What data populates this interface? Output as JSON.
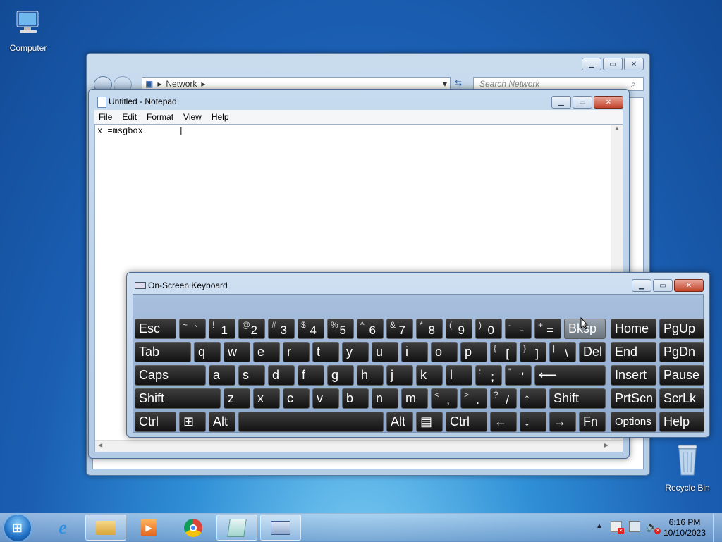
{
  "desktop": {
    "icons": [
      {
        "label": "Computer"
      },
      {
        "label": "Recycle Bin"
      }
    ]
  },
  "explorer": {
    "breadcrumb": "Network",
    "search_placeholder": "Search Network"
  },
  "notepad": {
    "title": "Untitled - Notepad",
    "menu": [
      "File",
      "Edit",
      "Format",
      "View",
      "Help"
    ],
    "text": "x =msgbox       |"
  },
  "osk": {
    "title": "On-Screen Keyboard",
    "keys": {
      "esc": "Esc",
      "tilde_top": "~",
      "tilde_bot": "`",
      "n1_top": "!",
      "n1": "1",
      "n2_top": "@",
      "n2": "2",
      "n3_top": "#",
      "n3": "3",
      "n4_top": "$",
      "n4": "4",
      "n5_top": "%",
      "n5": "5",
      "n6_top": "^",
      "n6": "6",
      "n7_top": "&",
      "n7": "7",
      "n8_top": "*",
      "n8": "8",
      "n9_top": "(",
      "n9": "9",
      "n0_top": ")",
      "n0": "0",
      "minus_top": "-",
      "minus": "-",
      "plus_top": "+",
      "equals": "=",
      "bksp": "Bksp",
      "home": "Home",
      "pgup": "PgUp",
      "tab": "Tab",
      "q": "q",
      "w": "w",
      "e": "e",
      "r": "r",
      "t": "t",
      "y": "y",
      "u": "u",
      "i": "i",
      "o": "o",
      "p": "p",
      "lbrace_top": "{",
      "lbrace": "[",
      "rbrace_top": "}",
      "rbrace": "]",
      "pipe_top": "|",
      "backslash": "\\",
      "del": "Del",
      "end": "End",
      "pgdn": "PgDn",
      "caps": "Caps",
      "a": "a",
      "s": "s",
      "d": "d",
      "f": "f",
      "g": "g",
      "h": "h",
      "j": "j",
      "k": "k",
      "l": "l",
      "colon_top": ":",
      "semicolon": ";",
      "quote_top": "\"",
      "quote": "'",
      "enter": "⟵",
      "insert": "Insert",
      "pause": "Pause",
      "shift": "Shift",
      "z": "z",
      "x": "x",
      "c": "c",
      "v": "v",
      "b": "b",
      "n": "n",
      "m": "m",
      "lt_top": "<",
      "comma": ",",
      "gt_top": ">",
      "period": ".",
      "q_top": "?",
      "slash": "/",
      "up": "↑",
      "shift_r": "Shift",
      "prtscn": "PrtScn",
      "scrlk": "ScrLk",
      "ctrl": "Ctrl",
      "win": "⊞",
      "alt": "Alt",
      "alt_r": "Alt",
      "menu": "▤",
      "ctrl_r": "Ctrl",
      "left": "←",
      "down": "↓",
      "right": "→",
      "fn": "Fn",
      "options": "Options",
      "help": "Help"
    }
  },
  "taskbar": {
    "clock_time": "6:16 PM",
    "clock_date": "10/10/2023"
  }
}
